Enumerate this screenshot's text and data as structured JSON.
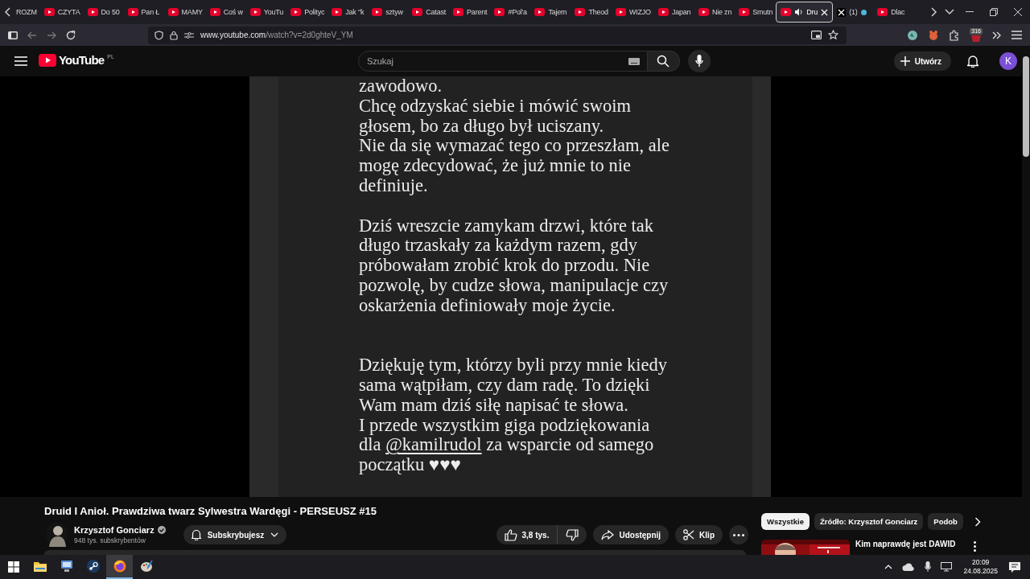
{
  "browser": {
    "tabs": [
      {
        "label": "ROZM",
        "kind": "plain",
        "selected": false,
        "audio": false
      },
      {
        "label": "CZYTA",
        "kind": "youtube",
        "selected": false,
        "audio": false
      },
      {
        "label": "Do 50",
        "kind": "youtube",
        "selected": false,
        "audio": false
      },
      {
        "label": "Pan Ł",
        "kind": "youtube",
        "selected": false,
        "audio": false
      },
      {
        "label": "MAMY",
        "kind": "youtube",
        "selected": false,
        "audio": false
      },
      {
        "label": "Coś w",
        "kind": "youtube",
        "selected": false,
        "audio": false
      },
      {
        "label": "YouTu",
        "kind": "youtube",
        "selected": false,
        "audio": false
      },
      {
        "label": "Polityc",
        "kind": "youtube",
        "selected": false,
        "audio": false
      },
      {
        "label": "Jak \"k",
        "kind": "youtube",
        "selected": false,
        "audio": false
      },
      {
        "label": "sztyw",
        "kind": "youtube",
        "selected": false,
        "audio": false
      },
      {
        "label": "Catast",
        "kind": "youtube",
        "selected": false,
        "audio": false
      },
      {
        "label": "Parent",
        "kind": "youtube",
        "selected": false,
        "audio": false
      },
      {
        "label": "#Pol'a",
        "kind": "youtube",
        "selected": false,
        "audio": false
      },
      {
        "label": "Tajem",
        "kind": "youtube",
        "selected": false,
        "audio": false
      },
      {
        "label": "Theod",
        "kind": "youtube",
        "selected": false,
        "audio": false
      },
      {
        "label": "WIZJO",
        "kind": "youtube",
        "selected": false,
        "audio": false
      },
      {
        "label": "Japan",
        "kind": "youtube",
        "selected": false,
        "audio": false
      },
      {
        "label": "Nie zn",
        "kind": "youtube",
        "selected": false,
        "audio": false
      },
      {
        "label": "Smutn",
        "kind": "youtube",
        "selected": false,
        "audio": false
      },
      {
        "label": "Dru",
        "kind": "youtube",
        "selected": true,
        "audio": true
      },
      {
        "label": "(1)",
        "kind": "x",
        "selected": false,
        "audio": false
      },
      {
        "label": "Dlac",
        "kind": "youtube",
        "selected": false,
        "audio": false
      }
    ],
    "url": {
      "host": "www.youtube.com",
      "path": "/watch?v=2d0ghteV_YM"
    },
    "extension_badge": "316"
  },
  "youtube": {
    "logo": "YouTube",
    "region": "PL",
    "search": {
      "placeholder": "Szukaj"
    },
    "create_button": "Utwórz",
    "avatar_letter": "K"
  },
  "video": {
    "paragraphs": [
      {
        "lines": [
          "zawodowo.",
          "Chcę odzyskać siebie i mówić swoim",
          "głosem, bo za długo był uciszany.",
          "Nie da się wymazać tego co przeszłam, ale",
          "mogę zdecydować, że już mnie to nie",
          "definiuje."
        ]
      },
      {
        "lines": [
          "Dziś wreszcie zamykam drzwi, które tak",
          "długo trzaskały za każdym razem, gdy",
          "próbowałam zrobić krok do przodu. Nie",
          "pozwolę, by cudze słowa, manipulacje czy",
          "oskarżenia definiowały moje życie."
        ]
      },
      {
        "lines": [
          "Dziękuję tym, którzy byli przy mnie kiedy",
          "sama wątpiłam, czy dam radę. To dzięki",
          "Wam mam dziś siłę napisać te słowa.",
          "I przede wszystkim  giga podziękowania",
          {
            "before": "dla ",
            "mention": "@kamilrudol",
            "after": " za wsparcie od samego"
          },
          "początku ♥♥♥"
        ]
      }
    ]
  },
  "info": {
    "title": "Druid I Anioł. Prawdziwa twarz Sylwestra Wardęgi - PERSEUSZ #15",
    "channel": "Krzysztof Gonciarz",
    "verified": true,
    "subscribers": "948 tys. subskrybentów",
    "subscribe_button": "Subskrybujesz",
    "likes": "3,8 tys.",
    "share": "Udostępnij",
    "clip": "Klip"
  },
  "sidebar": {
    "chips": [
      {
        "label": "Wszystkie",
        "selected": true
      },
      {
        "label": "Źródło: Krzysztof Gonciarz",
        "selected": false
      },
      {
        "label": "Podob",
        "selected": false
      }
    ],
    "recommendation": {
      "title": "Kim naprawdę jest DAWID",
      "kind": "picture"
    }
  },
  "taskbar": {
    "apps": [
      {
        "kind": "explorer",
        "active": false
      },
      {
        "kind": "remote",
        "active": false
      },
      {
        "kind": "steam",
        "active": false
      },
      {
        "kind": "firefox",
        "active": true
      },
      {
        "kind": "paint",
        "active": false
      }
    ],
    "time": "20:09",
    "date": "24.08.2025"
  }
}
